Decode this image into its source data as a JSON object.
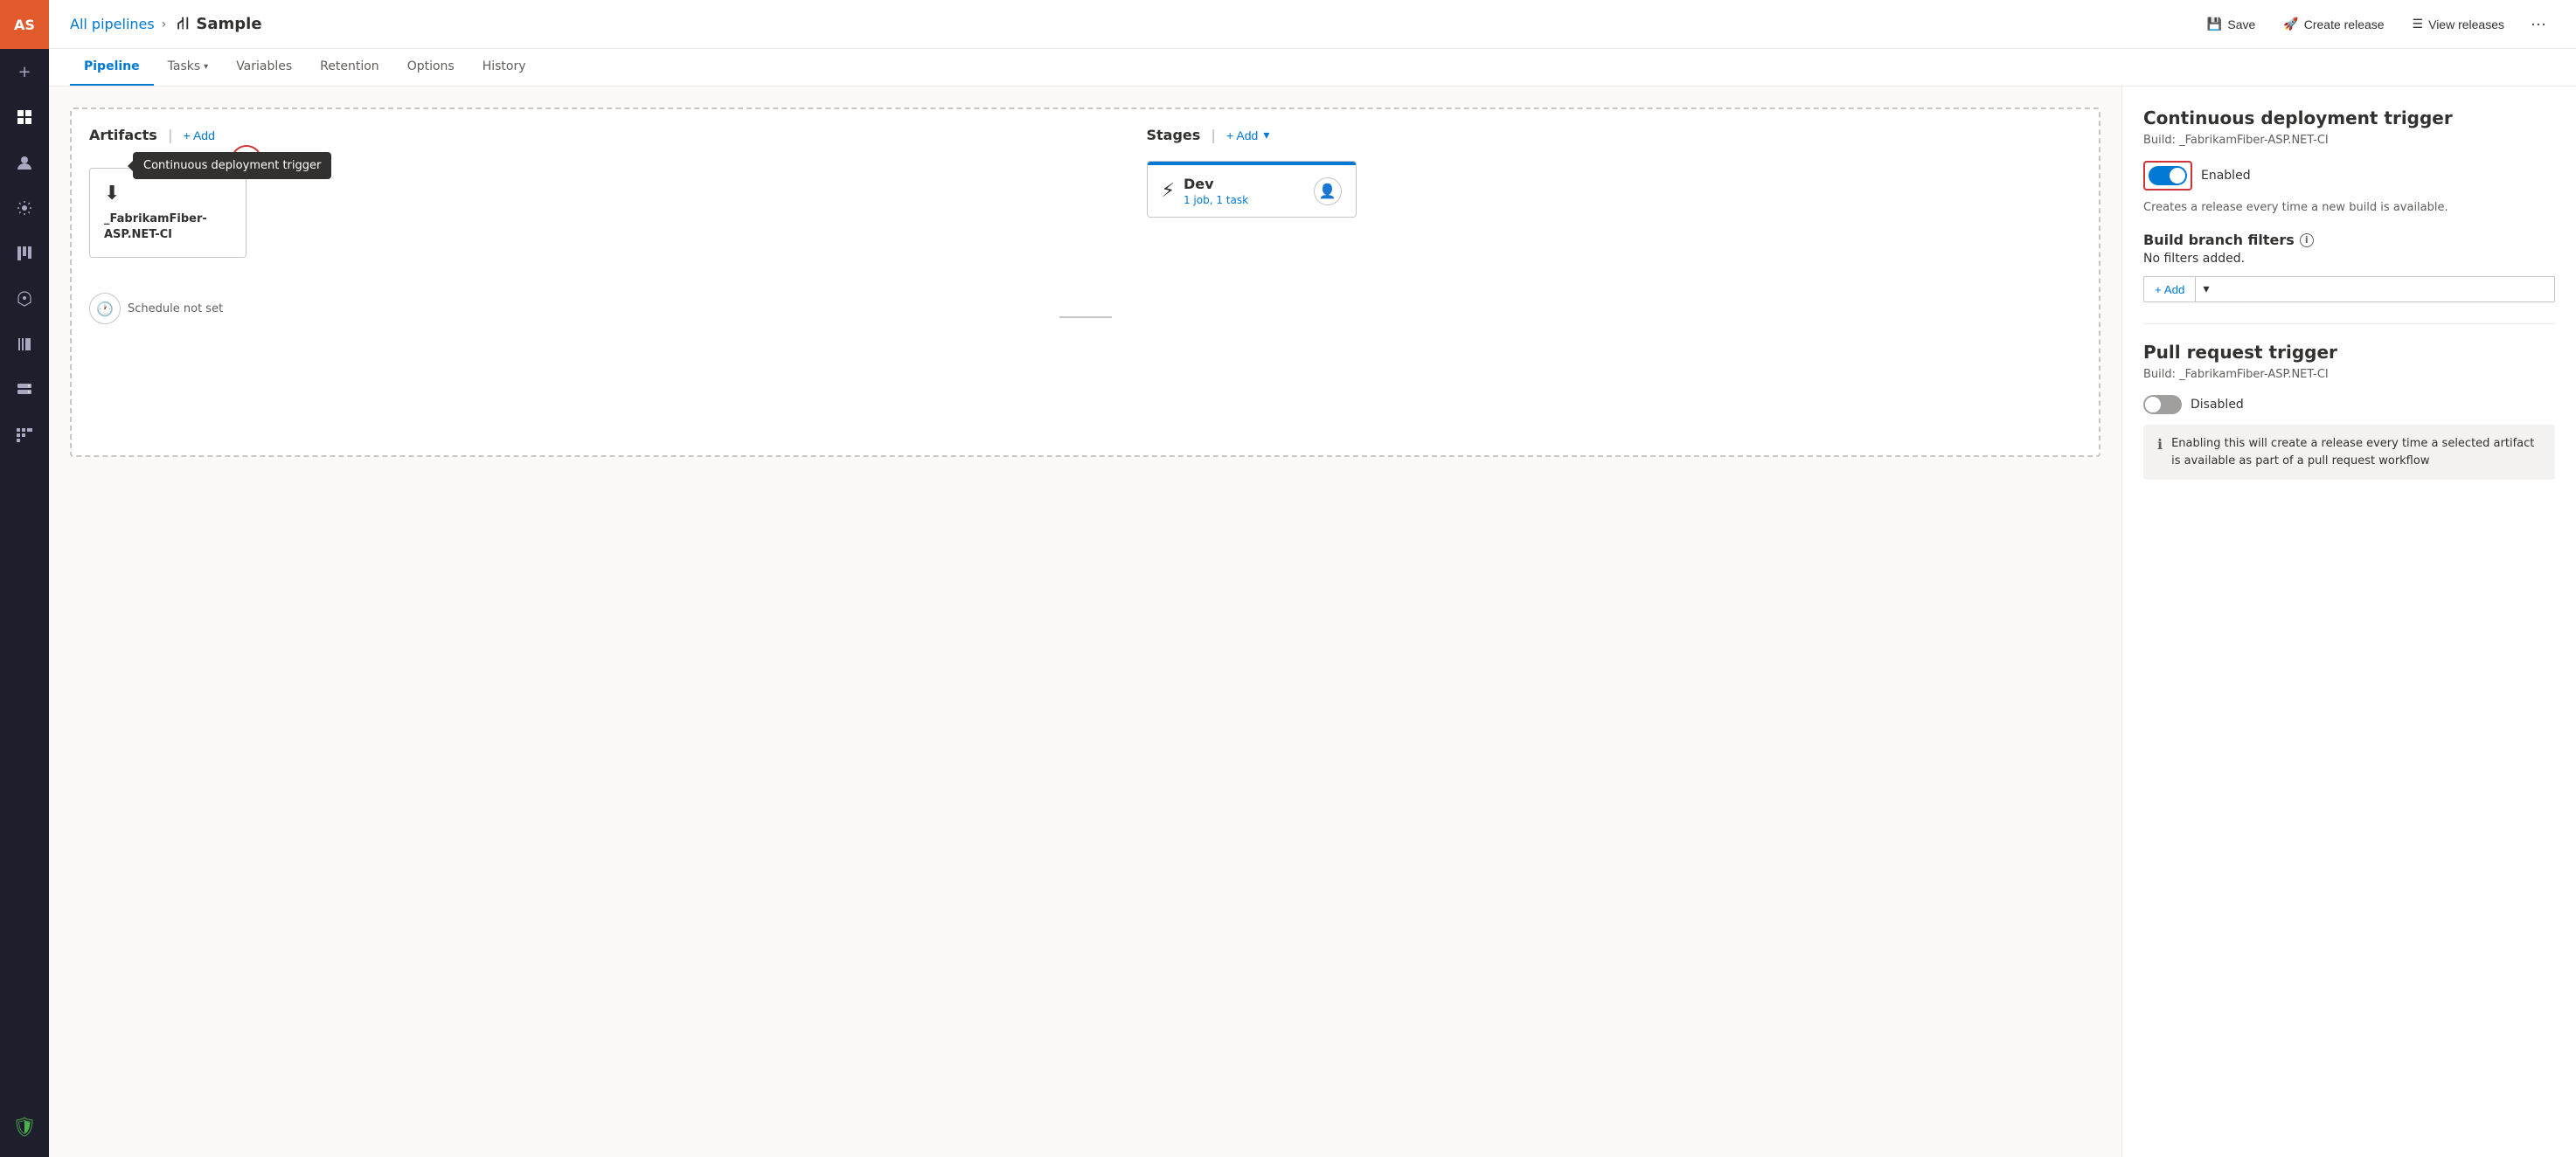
{
  "sidebar": {
    "avatar": "AS",
    "icons": [
      {
        "name": "plus-icon",
        "symbol": "+",
        "interactable": true
      },
      {
        "name": "dashboard-icon",
        "symbol": "⊞",
        "interactable": true
      },
      {
        "name": "user-icon",
        "symbol": "👤",
        "interactable": true
      },
      {
        "name": "deploy-icon",
        "symbol": "⚙",
        "interactable": true
      },
      {
        "name": "boards-icon",
        "symbol": "▦",
        "interactable": true
      },
      {
        "name": "rocket-icon",
        "symbol": "🚀",
        "interactable": true
      },
      {
        "name": "library-icon",
        "symbol": "≡",
        "interactable": true
      },
      {
        "name": "server-icon",
        "symbol": "▤",
        "interactable": true
      },
      {
        "name": "pipeline2-icon",
        "symbol": "⊟",
        "interactable": true
      }
    ],
    "shield_label": "🛡"
  },
  "topbar": {
    "breadcrumb_link": "All pipelines",
    "separator": "›",
    "pipeline_icon": "⟿",
    "title": "Sample",
    "save_label": "Save",
    "create_release_label": "Create release",
    "view_releases_label": "View releases"
  },
  "nav": {
    "tabs": [
      {
        "id": "pipeline",
        "label": "Pipeline",
        "active": true,
        "has_dropdown": false
      },
      {
        "id": "tasks",
        "label": "Tasks",
        "active": false,
        "has_dropdown": true
      },
      {
        "id": "variables",
        "label": "Variables",
        "active": false,
        "has_dropdown": false
      },
      {
        "id": "retention",
        "label": "Retention",
        "active": false,
        "has_dropdown": false
      },
      {
        "id": "options",
        "label": "Options",
        "active": false,
        "has_dropdown": false
      },
      {
        "id": "history",
        "label": "History",
        "active": false,
        "has_dropdown": false
      }
    ]
  },
  "pipeline": {
    "artifacts_label": "Artifacts",
    "stages_label": "Stages",
    "add_label": "+ Add",
    "artifact": {
      "name": "_FabrikamFiber-ASP.NET-CI",
      "icon": "⬇"
    },
    "cd_trigger_tooltip": "Continuous deployment trigger",
    "schedule_label": "Schedule not set",
    "stage": {
      "name": "Dev",
      "meta": "1 job, 1 task",
      "icon": "⚡"
    }
  },
  "right_panel": {
    "cd_trigger": {
      "title": "Continuous deployment trigger",
      "subtitle": "Build: _FabrikamFiber-ASP.NET-CI",
      "toggle_state": "on",
      "toggle_label": "Enabled",
      "description": "Creates a release every time a new build is available."
    },
    "build_branch_filters": {
      "title": "Build branch filters",
      "no_filters": "No filters added.",
      "add_label": "+ Add"
    },
    "pr_trigger": {
      "title": "Pull request trigger",
      "subtitle": "Build: _FabrikamFiber-ASP.NET-CI",
      "toggle_state": "off",
      "toggle_label": "Disabled",
      "info_text": "Enabling this will create a release every time a selected artifact is available as part of a pull request workflow"
    }
  }
}
